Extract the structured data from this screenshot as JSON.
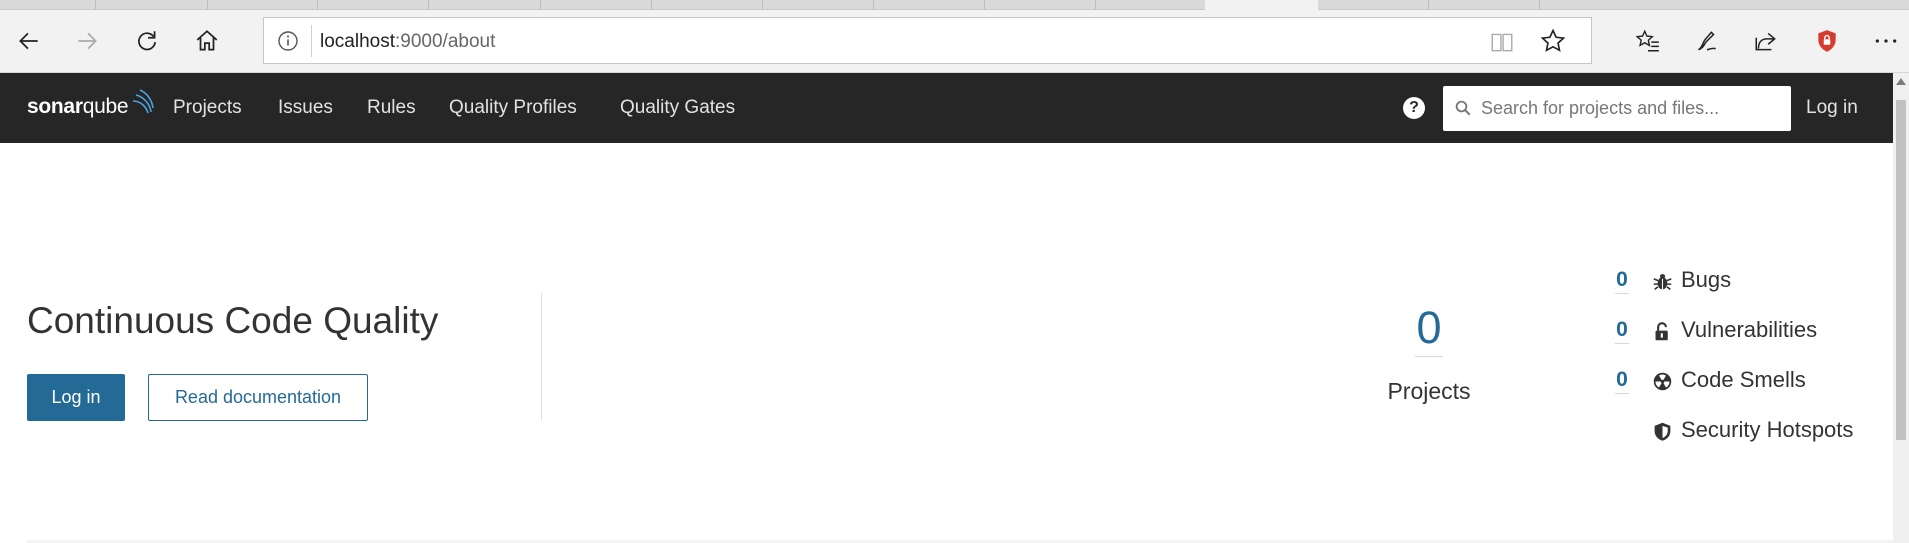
{
  "browser": {
    "url_host": "localhost",
    "url_rest": ":9000/about"
  },
  "nav": {
    "logo_text_bold": "sonar",
    "logo_text_light": "qube",
    "links": [
      "Projects",
      "Issues",
      "Rules",
      "Quality Profiles",
      "Quality Gates"
    ],
    "help_label": "?",
    "search_placeholder": "Search for projects and files...",
    "login_label": "Log in"
  },
  "hero": {
    "title": "Continuous Code Quality",
    "login_button": "Log in",
    "docs_button": "Read documentation"
  },
  "stats": {
    "projects_count": "0",
    "projects_label": "Projects",
    "measures": [
      {
        "count": "0",
        "label": "Bugs",
        "icon": "bug-icon"
      },
      {
        "count": "0",
        "label": "Vulnerabilities",
        "icon": "lock-icon"
      },
      {
        "count": "0",
        "label": "Code Smells",
        "icon": "code-smell-icon"
      },
      {
        "count": "",
        "label": "Security Hotspots",
        "icon": "shield-icon"
      }
    ]
  },
  "colors": {
    "nav_bg": "#262626",
    "accent": "#236a97"
  }
}
